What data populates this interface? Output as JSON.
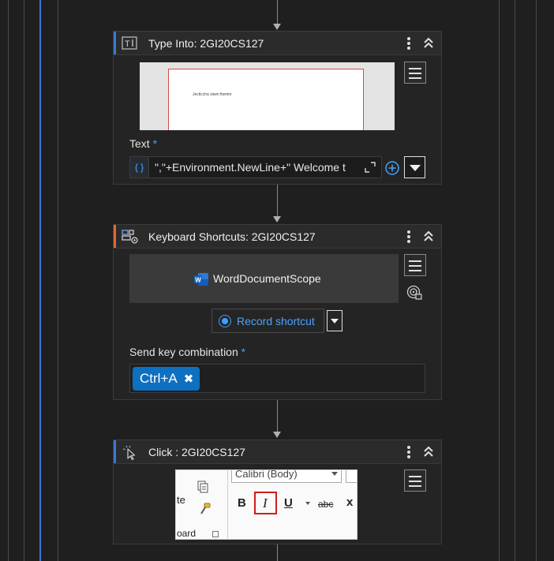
{
  "workflow": {
    "activities": [
      {
        "title": "Type Into: 2GI20CS127",
        "icon": "type-into-icon",
        "accent": "#3c78d8",
        "thumbnail_text": "Jecticcha siwm fiwmm",
        "field_label": "Text",
        "required_marker": "*",
        "expression_badge": "{ }",
        "expression_value": "\",\"+Environment.NewLine+\" Welcome t"
      },
      {
        "title": "Keyboard Shortcuts: 2GI20CS127",
        "icon": "keyboard-shortcuts-icon",
        "accent": "#e06c2e",
        "scope_label": "WordDocumentScope",
        "scope_icon": "word-icon",
        "record_label": "Record shortcut",
        "field_label": "Send key combination",
        "required_marker": "*",
        "key_token": "Ctrl+A",
        "remove_glyph": "✖"
      },
      {
        "title": "Click : 2GI20CS127",
        "icon": "click-icon",
        "accent": "#3c78d8",
        "ribbon": {
          "font_name": "Calibri (Body)",
          "paste_label": "te",
          "clipboard_label": "oard",
          "bold": "B",
          "italic": "I",
          "underline": "U",
          "strike": "abc",
          "subscript": "x"
        }
      }
    ]
  },
  "colors": {
    "background": "#1f1f1f",
    "card": "#242424",
    "header": "#2b2b2b",
    "link_blue": "#3aa0ff",
    "token_blue": "#0e70c0",
    "highlight_red": "#d01c1c"
  }
}
